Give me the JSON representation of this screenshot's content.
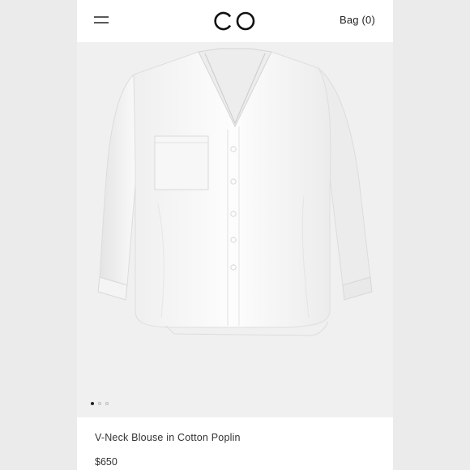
{
  "header": {
    "menu_icon": "hamburger-menu-icon",
    "logo_text": "CO",
    "bag_label": "Bag (0)"
  },
  "gallery": {
    "image_count": 3,
    "active_index": 0
  },
  "product": {
    "name": "V-Neck Blouse in Cotton Poplin",
    "price": "$650"
  },
  "colors": {
    "background": "#ffffff",
    "image_background": "#f0f0f0",
    "text": "#333333"
  }
}
